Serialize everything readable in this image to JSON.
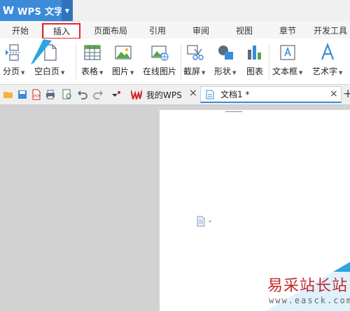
{
  "app": {
    "title": "WPS 文字",
    "logo_glyph": "W"
  },
  "menu": {
    "tabs": [
      {
        "label": "开始"
      },
      {
        "label": "插入"
      },
      {
        "label": "页面布局"
      },
      {
        "label": "引用"
      },
      {
        "label": "审阅"
      },
      {
        "label": "视图"
      },
      {
        "label": "章节"
      },
      {
        "label": "开发工具"
      }
    ],
    "active": "插入"
  },
  "ribbon": {
    "buttons": [
      {
        "label": "分页",
        "icon": "page-break-icon",
        "dropdown": true
      },
      {
        "label": "空白页",
        "icon": "blank-page-icon",
        "dropdown": true
      },
      {
        "label": "表格",
        "icon": "table-icon",
        "dropdown": true
      },
      {
        "label": "图片",
        "icon": "picture-icon",
        "dropdown": true
      },
      {
        "label": "在线图片",
        "icon": "online-picture-icon",
        "dropdown": false
      },
      {
        "label": "截屏",
        "icon": "screenshot-icon",
        "dropdown": true
      },
      {
        "label": "形状",
        "icon": "shapes-icon",
        "dropdown": true
      },
      {
        "label": "图表",
        "icon": "chart-icon",
        "dropdown": false
      },
      {
        "label": "文本框",
        "icon": "textbox-icon",
        "dropdown": true
      },
      {
        "label": "艺术字",
        "icon": "wordart-icon",
        "dropdown": true
      }
    ]
  },
  "doc_tabs": [
    {
      "label": "我的WPS",
      "close": "×"
    },
    {
      "label": "文档1 *",
      "close": "×"
    }
  ],
  "new_tab": "+",
  "watermark": {
    "text": "易采站长站",
    "url": "www.easck.com"
  },
  "colors": {
    "accent": "#3b8bd8",
    "highlight": "#e6262a",
    "wps_red": "#d9262b",
    "cyan": "#2aa6e0"
  }
}
